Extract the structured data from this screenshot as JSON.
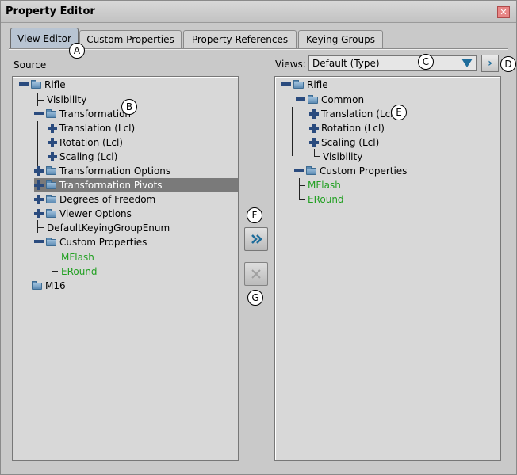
{
  "window": {
    "title": "Property Editor",
    "close_glyph": "✕"
  },
  "tabs": [
    {
      "label": "View Editor"
    },
    {
      "label": "Custom Properties"
    },
    {
      "label": "Property References"
    },
    {
      "label": "Keying Groups"
    }
  ],
  "source": {
    "label": "Source",
    "tree": {
      "rifle": "Rifle",
      "visibility": "Visibility",
      "transformation": "Transformation",
      "translation": "Translation (Lcl)",
      "rotation": "Rotation (Lcl)",
      "scaling": "Scaling (Lcl)",
      "transformation_options": "Transformation Options",
      "transformation_pivots": "Transformation Pivots",
      "degrees_of_freedom": "Degrees of Freedom",
      "viewer_options": "Viewer Options",
      "default_keying_group_enum": "DefaultKeyingGroupEnum",
      "custom_properties": "Custom Properties",
      "mflash": "MFlash",
      "eround": "ERound",
      "m16": "M16"
    }
  },
  "views": {
    "label": "Views:",
    "selected": "Default (Type)",
    "next_glyph": "›",
    "tree": {
      "rifle": "Rifle",
      "common": "Common",
      "translation": "Translation (Lcl)",
      "rotation": "Rotation (Lcl)",
      "scaling": "Scaling (Lcl)",
      "visibility": "Visibility",
      "custom_properties": "Custom Properties",
      "mflash": "MFlash",
      "eround": "ERound"
    }
  },
  "buttons": {
    "add_glyph": "»",
    "remove_glyph": "✕"
  },
  "callouts": {
    "a": "A",
    "b": "B",
    "c": "C",
    "d": "D",
    "e": "E",
    "f": "F",
    "g": "G"
  },
  "colors": {
    "custom_property_text": "#22a022",
    "selection": "#7a7a7a",
    "accent": "#1f6d9b"
  }
}
